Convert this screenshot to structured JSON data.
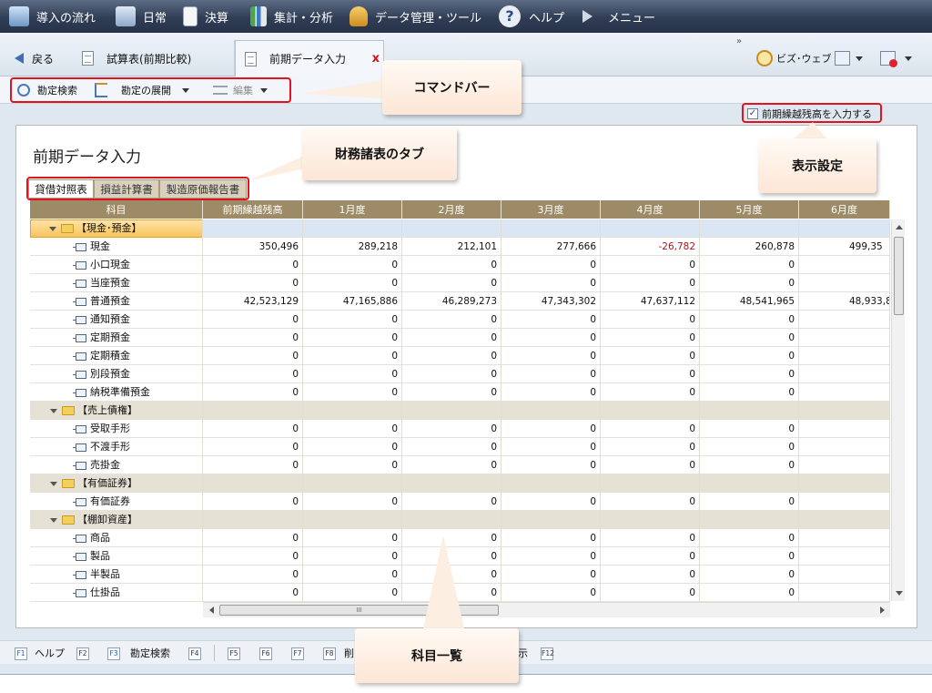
{
  "menu": [
    {
      "label": "導入の流れ",
      "icon": "flow-icon"
    },
    {
      "label": "日常",
      "icon": "pen-icon"
    },
    {
      "label": "決算",
      "icon": "document-icon"
    },
    {
      "label": "集計・分析",
      "icon": "chart-icon"
    },
    {
      "label": "データ管理・ツール",
      "icon": "database-icon"
    },
    {
      "label": "ヘルプ",
      "icon": "help-icon"
    },
    {
      "label": "メニュー",
      "icon": "play-icon"
    }
  ],
  "nav": {
    "back_label": "戻る",
    "tabs": [
      {
        "label": "試算表(前期比較)",
        "active": false
      },
      {
        "label": "前期データ入力",
        "active": true
      }
    ],
    "close_glyph": "x",
    "overflow_glyph": "»",
    "bizweb_label": "ビズ･ウェブ"
  },
  "commands": {
    "search_label": "勘定検索",
    "expand_label": "勘定の展開",
    "edit_label": "編集"
  },
  "options": {
    "carryover_label": "前期繰越残高を入力する",
    "carryover_checked": true
  },
  "page": {
    "title": "前期データ入力",
    "sheet_tabs": [
      "貸借対照表",
      "損益計算書",
      "製造原価報告書"
    ]
  },
  "grid": {
    "columns": [
      "科目",
      "前期繰越残高",
      "1月度",
      "2月度",
      "3月度",
      "4月度",
      "5月度",
      "6月度"
    ],
    "rows": [
      {
        "type": "category",
        "label": "【現金･預金】",
        "selected": true
      },
      {
        "type": "account",
        "label": "現金",
        "values": [
          "350,496",
          "289,218",
          "212,101",
          "277,666",
          "-26,782",
          "260,878",
          "499,35"
        ]
      },
      {
        "type": "account",
        "label": "小口現金",
        "values": [
          "0",
          "0",
          "0",
          "0",
          "0",
          "0",
          ""
        ]
      },
      {
        "type": "account",
        "label": "当座預金",
        "values": [
          "0",
          "0",
          "0",
          "0",
          "0",
          "0",
          ""
        ]
      },
      {
        "type": "account",
        "label": "普通預金",
        "values": [
          "42,523,129",
          "47,165,886",
          "46,289,273",
          "47,343,302",
          "47,637,112",
          "48,541,965",
          "48,933,88"
        ]
      },
      {
        "type": "account",
        "label": "通知預金",
        "values": [
          "0",
          "0",
          "0",
          "0",
          "0",
          "0",
          ""
        ]
      },
      {
        "type": "account",
        "label": "定期預金",
        "values": [
          "0",
          "0",
          "0",
          "0",
          "0",
          "0",
          ""
        ]
      },
      {
        "type": "account",
        "label": "定期積金",
        "values": [
          "0",
          "0",
          "0",
          "0",
          "0",
          "0",
          ""
        ]
      },
      {
        "type": "account",
        "label": "別段預金",
        "values": [
          "0",
          "0",
          "0",
          "0",
          "0",
          "0",
          ""
        ]
      },
      {
        "type": "account",
        "label": "納税準備預金",
        "values": [
          "0",
          "0",
          "0",
          "0",
          "0",
          "0",
          ""
        ]
      },
      {
        "type": "category",
        "label": "【売上債権】"
      },
      {
        "type": "account",
        "label": "受取手形",
        "values": [
          "0",
          "0",
          "0",
          "0",
          "0",
          "0",
          ""
        ]
      },
      {
        "type": "account",
        "label": "不渡手形",
        "values": [
          "0",
          "0",
          "0",
          "0",
          "0",
          "0",
          ""
        ]
      },
      {
        "type": "account",
        "label": "売掛金",
        "values": [
          "0",
          "0",
          "0",
          "0",
          "0",
          "0",
          ""
        ]
      },
      {
        "type": "category",
        "label": "【有価証券】"
      },
      {
        "type": "account",
        "label": "有価証券",
        "values": [
          "0",
          "0",
          "0",
          "0",
          "0",
          "0",
          ""
        ]
      },
      {
        "type": "category",
        "label": "【棚卸資産】"
      },
      {
        "type": "account",
        "label": "商品",
        "values": [
          "0",
          "0",
          "0",
          "0",
          "0",
          "0",
          ""
        ]
      },
      {
        "type": "account",
        "label": "製品",
        "values": [
          "0",
          "0",
          "0",
          "0",
          "0",
          "0",
          ""
        ]
      },
      {
        "type": "account",
        "label": "半製品",
        "values": [
          "0",
          "0",
          "0",
          "0",
          "0",
          "0",
          ""
        ]
      },
      {
        "type": "account",
        "label": "仕掛品",
        "values": [
          "0",
          "0",
          "0",
          "0",
          "0",
          "0",
          ""
        ]
      }
    ],
    "hscroll_glyph": "III"
  },
  "callouts": {
    "command_bar": "コマンドバー",
    "sheet_tabs": "財務諸表のタブ",
    "display_settings": "表示設定",
    "account_list": "科目一覧"
  },
  "fkeys": [
    {
      "key": "F1",
      "label": "ヘルプ"
    },
    {
      "key": "F2",
      "label": ""
    },
    {
      "key": "F3",
      "label": "勘定検索"
    },
    {
      "key": "F4",
      "label": ""
    },
    {
      "key": "F5",
      "label": ""
    },
    {
      "key": "F6",
      "label": ""
    },
    {
      "key": "F7",
      "label": ""
    },
    {
      "key": "F8",
      "label": "削"
    },
    {
      "key": "F12",
      "label": ""
    }
  ],
  "fkey_hidden_tail": "示",
  "colors": {
    "menubar": "#2f3d55",
    "grid_header": "#9c8b66",
    "highlight_red": "#e0141e",
    "negative": "#b3121a",
    "callout": "#fde6d6"
  }
}
